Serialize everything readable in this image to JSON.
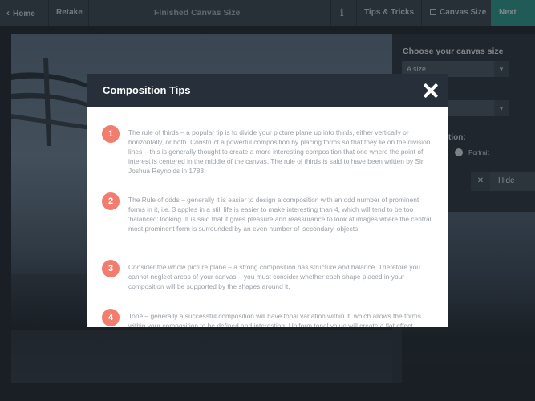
{
  "topbar": {
    "home_label": "Home",
    "retake_label": "Retake",
    "title": "Finished Canvas Size",
    "info_label": "i",
    "tips_label": "Tips & Tricks",
    "canvas_size_label": "Canvas Size",
    "next_label": "Next"
  },
  "panel": {
    "title": "Choose your canvas size",
    "size_select_value": "A size",
    "orientation_label": "tion:",
    "portrait_label": "Portrait",
    "hide_label": "Hide"
  },
  "modal": {
    "title": "Composition Tips",
    "tips": [
      {
        "number": "1",
        "text": "The rule of thirds – a popular tip is to divide your picture plane up into thirds, either vertically or horizontally, or both. Construct a powerful composition by placing forms so that they lie on the division lines – this is generally thought to create a more interesting composition that one where the point of interest is centered in the middle of the canvas. The rule of thirds is said to have been written by Sir Joshua Reynolds in 1783."
      },
      {
        "number": "2",
        "text": "The Rule of odds – generally it is easier to design a composition with an odd number of prominent forms in it, i.e. 3 apples in a still life is easier to make interesting than 4, which will tend to be too 'balanced' looking. It is said that it gives pleasure and reassurance to look at images where the central most prominent form is surrounded by an even number of 'secondary' objects."
      },
      {
        "number": "3",
        "text": "Consider the whole picture plane – a strong composition has structure and balance. Therefore you cannot neglect areas of your canvas – you must consider whether each shape placed in your composition will be supported by the shapes around it."
      },
      {
        "number": "4",
        "text": "Tone – generally a successful composition will have tonal variation within it, which allows the forms within your composition to be defined and interesting. Uniform tonal value will create a flat effect."
      }
    ]
  },
  "colors": {
    "accent_teal": "#2f9a8e",
    "tip_badge": "#f27c6e",
    "modal_header": "#27303a"
  }
}
